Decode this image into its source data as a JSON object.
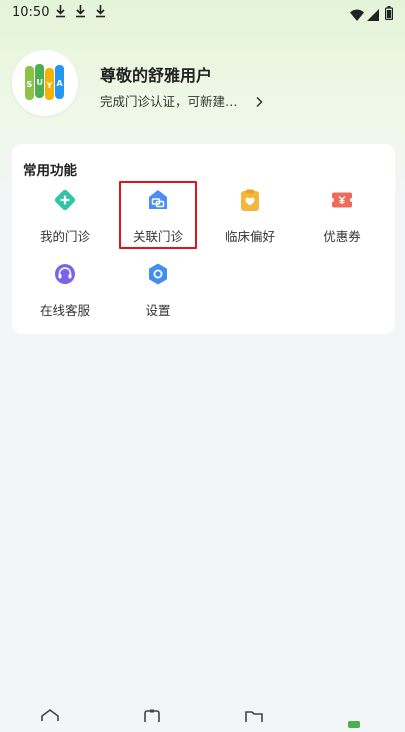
{
  "status_bar": {
    "time": "10:50",
    "download_icons": [
      "download-icon",
      "download-icon",
      "download-icon"
    ],
    "system_icons": [
      "wifi-icon",
      "signal-icon",
      "battery-icon"
    ]
  },
  "profile": {
    "avatar_logo_text": "SUYA",
    "name": "尊敬的舒雅用户",
    "subtitle": "完成门诊认证，可新建…"
  },
  "functions": {
    "title": "常用功能",
    "items": [
      {
        "label": "我的门诊",
        "icon": "plus-diamond-icon",
        "color": "#2ec6a6"
      },
      {
        "label": "关联门诊",
        "icon": "link-clinic-icon",
        "color": "#4b8cf5",
        "highlighted": true
      },
      {
        "label": "临床偏好",
        "icon": "heart-clipboard-icon",
        "color": "#f5b73b"
      },
      {
        "label": "优惠券",
        "icon": "coupon-icon",
        "color": "#f06a5b"
      },
      {
        "label": "在线客服",
        "icon": "headset-icon",
        "color": "#7b63e6"
      },
      {
        "label": "设置",
        "icon": "settings-icon",
        "color": "#3f8ef0"
      }
    ]
  },
  "bottom_nav": [
    "home-icon",
    "clipboard-icon",
    "folder-icon",
    "profile-icon"
  ],
  "colors": {
    "accent_green": "#4caf50",
    "highlight_red": "#e0141a"
  }
}
